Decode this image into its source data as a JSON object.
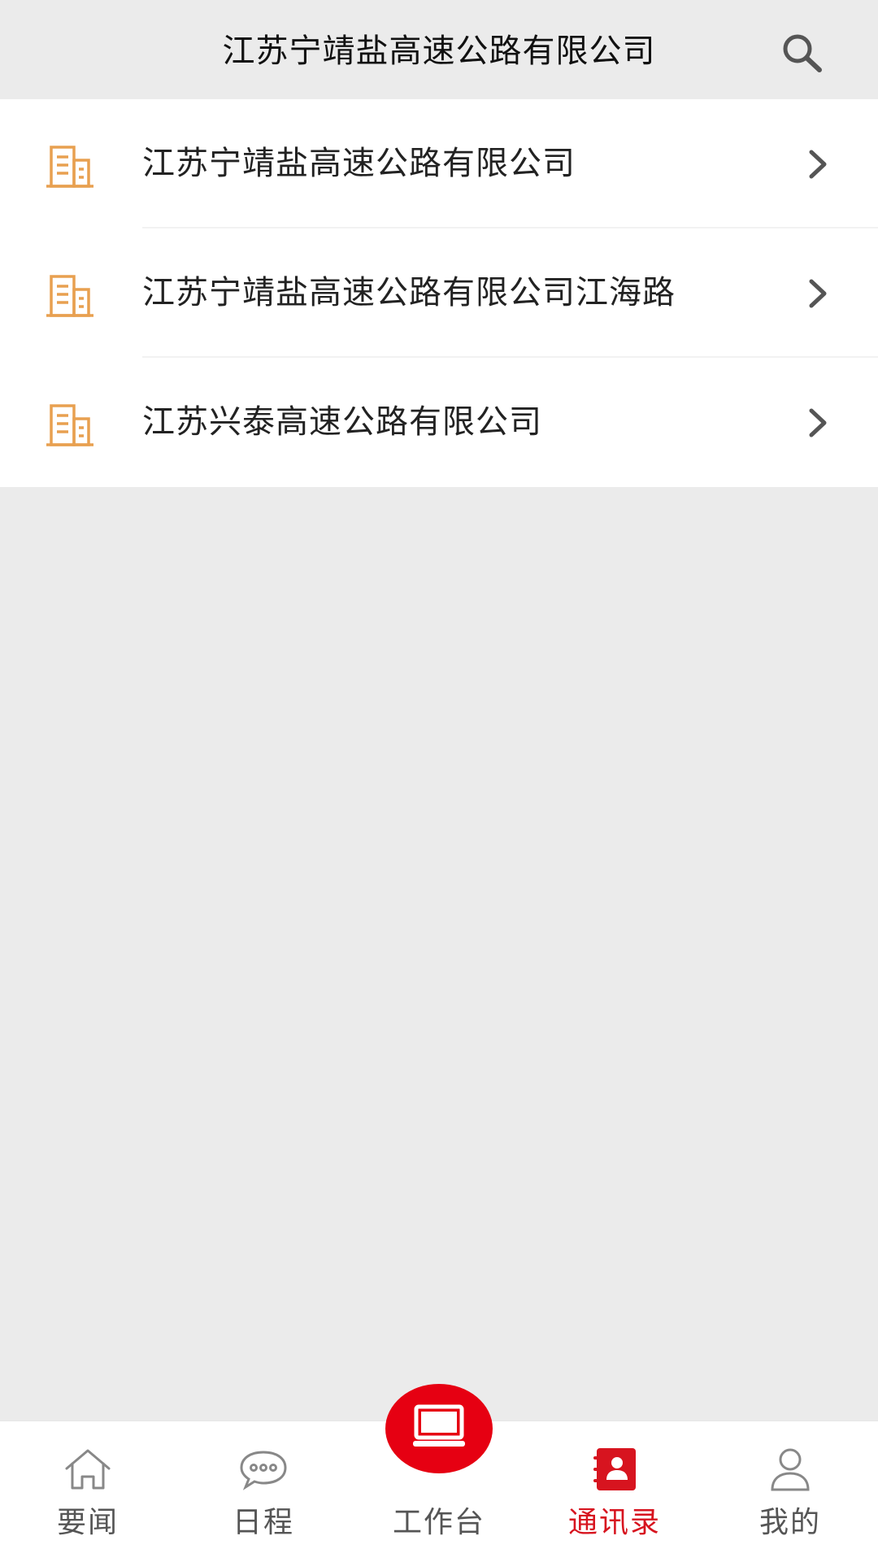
{
  "header": {
    "title": "江苏宁靖盐高速公路有限公司",
    "search_icon": "search-icon"
  },
  "companies": [
    {
      "name": "江苏宁靖盐高速公路有限公司",
      "icon": "building-icon"
    },
    {
      "name": "江苏宁靖盐高速公路有限公司江海路",
      "icon": "building-icon"
    },
    {
      "name": "江苏兴泰高速公路有限公司",
      "icon": "building-icon"
    }
  ],
  "tabbar": {
    "items": [
      {
        "label": "要闻",
        "icon": "home-icon",
        "active": false
      },
      {
        "label": "日程",
        "icon": "chat-bubble-icon",
        "active": false
      },
      {
        "label": "工作台",
        "icon": "monitor-icon",
        "active": false
      },
      {
        "label": "通讯录",
        "icon": "contacts-icon",
        "active": true
      },
      {
        "label": "我的",
        "icon": "user-icon",
        "active": false
      }
    ]
  },
  "colors": {
    "accent": "#e60012",
    "building_icon": "#e8a050",
    "background": "#ebebeb"
  }
}
